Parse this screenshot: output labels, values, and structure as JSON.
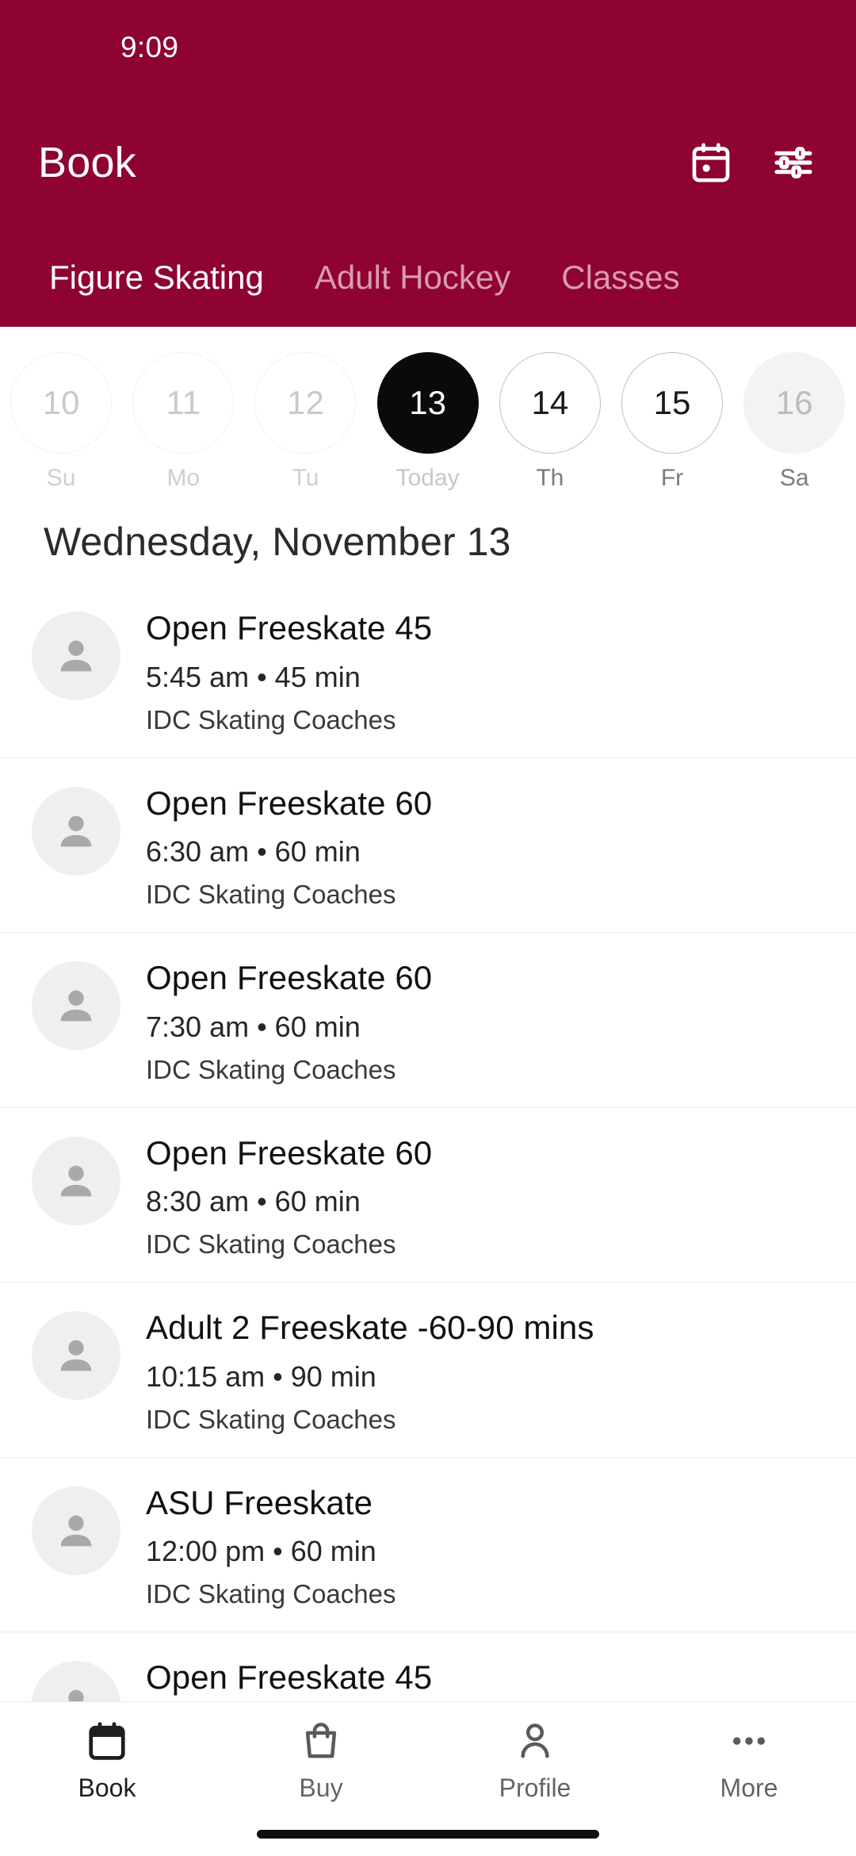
{
  "theme": {
    "brand_maroon": "#8E0333",
    "selected_day_bg": "#0A0A0A",
    "text_primary": "#111111",
    "text_muted": "#646464",
    "divider": "#EDEDED"
  },
  "status_bar": {
    "time": "9:09"
  },
  "app_bar": {
    "title": "Book",
    "calendar_icon": "calendar-icon",
    "filter_icon": "filter-sliders-icon"
  },
  "tabs": [
    {
      "label": "Figure Skating",
      "active": true
    },
    {
      "label": "Adult Hockey",
      "active": false
    },
    {
      "label": "Classes",
      "active": false
    }
  ],
  "date_strip": [
    {
      "day": "10",
      "weekday": "Su",
      "state": "past"
    },
    {
      "day": "11",
      "weekday": "Mo",
      "state": "past"
    },
    {
      "day": "12",
      "weekday": "Tu",
      "state": "past"
    },
    {
      "day": "13",
      "weekday": "Today",
      "state": "selected"
    },
    {
      "day": "14",
      "weekday": "Th",
      "state": "future"
    },
    {
      "day": "15",
      "weekday": "Fr",
      "state": "future"
    },
    {
      "day": "16",
      "weekday": "Sa",
      "state": "filled"
    }
  ],
  "day_heading": "Wednesday, November 13",
  "sessions": [
    {
      "title": "Open Freeskate 45",
      "meta": "5:45 am • 45 min",
      "provider": "IDC Skating Coaches",
      "avatar_icon": "person-avatar-icon"
    },
    {
      "title": "Open Freeskate 60",
      "meta": "6:30 am • 60 min",
      "provider": "IDC Skating Coaches",
      "avatar_icon": "person-avatar-icon"
    },
    {
      "title": "Open Freeskate 60",
      "meta": "7:30 am • 60 min",
      "provider": "IDC Skating Coaches",
      "avatar_icon": "person-avatar-icon"
    },
    {
      "title": "Open Freeskate 60",
      "meta": "8:30 am • 60 min",
      "provider": "IDC Skating Coaches",
      "avatar_icon": "person-avatar-icon"
    },
    {
      "title": "Adult 2 Freeskate -60-90 mins",
      "meta": "10:15 am • 90 min",
      "provider": "IDC Skating Coaches",
      "avatar_icon": "person-avatar-icon"
    },
    {
      "title": "ASU Freeskate",
      "meta": "12:00 pm • 60 min",
      "provider": "IDC Skating Coaches",
      "avatar_icon": "person-avatar-icon"
    },
    {
      "title": "Open Freeskate 45",
      "meta": "",
      "provider": "",
      "avatar_icon": "person-avatar-icon"
    }
  ],
  "bottom_nav": [
    {
      "label": "Book",
      "icon": "calendar-icon",
      "active": true
    },
    {
      "label": "Buy",
      "icon": "shopping-bag-icon",
      "active": false
    },
    {
      "label": "Profile",
      "icon": "person-icon",
      "active": false
    },
    {
      "label": "More",
      "icon": "ellipsis-icon",
      "active": false
    }
  ]
}
